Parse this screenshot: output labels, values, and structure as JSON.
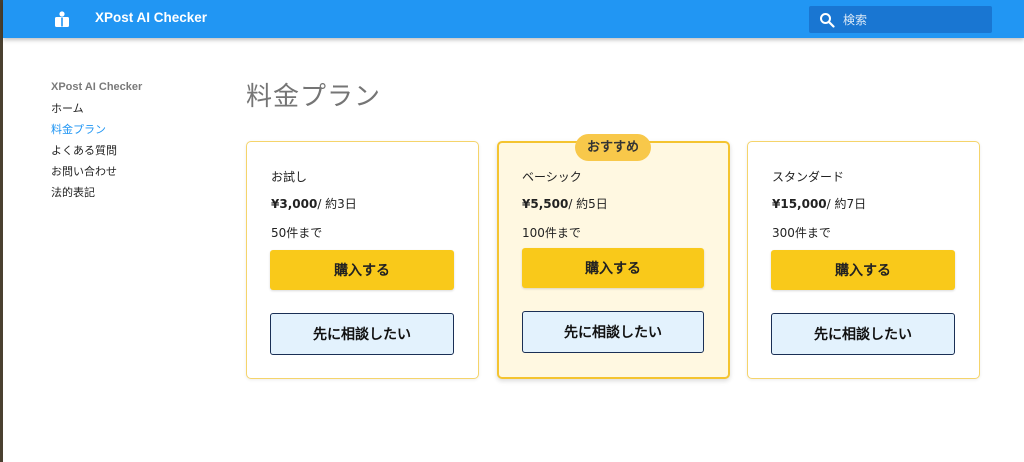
{
  "header": {
    "app_title": "XPost AI Checker",
    "search_placeholder": "検索",
    "logo_icon": "book-icon",
    "search_icon": "search-icon"
  },
  "colors": {
    "primary": "#2196f3",
    "accent": "#f9c91a",
    "badge": "#f8c84a",
    "consult_bg": "#e3f2fd"
  },
  "sidebar": {
    "title": "XPost AI Checker",
    "items": [
      {
        "label": "ホーム",
        "active": false
      },
      {
        "label": "料金プラン",
        "active": true
      },
      {
        "label": "よくある質問",
        "active": false
      },
      {
        "label": "お問い合わせ",
        "active": false
      },
      {
        "label": "法的表記",
        "active": false
      }
    ]
  },
  "main": {
    "page_title": "料金プラン",
    "plans": [
      {
        "name": "お試し",
        "price": "¥3,000",
        "period": "/ 約3日",
        "limit": "50件まで",
        "buy_label": "購入する",
        "consult_label": "先に相談したい",
        "featured": false
      },
      {
        "name": "ベーシック",
        "price": "¥5,500",
        "period": "/ 約5日",
        "limit": "100件まで",
        "buy_label": "購入する",
        "consult_label": "先に相談したい",
        "featured": true,
        "badge": "おすすめ"
      },
      {
        "name": "スタンダード",
        "price": "¥15,000",
        "period": "/ 約7日",
        "limit": "300件まで",
        "buy_label": "購入する",
        "consult_label": "先に相談したい",
        "featured": false
      }
    ]
  }
}
